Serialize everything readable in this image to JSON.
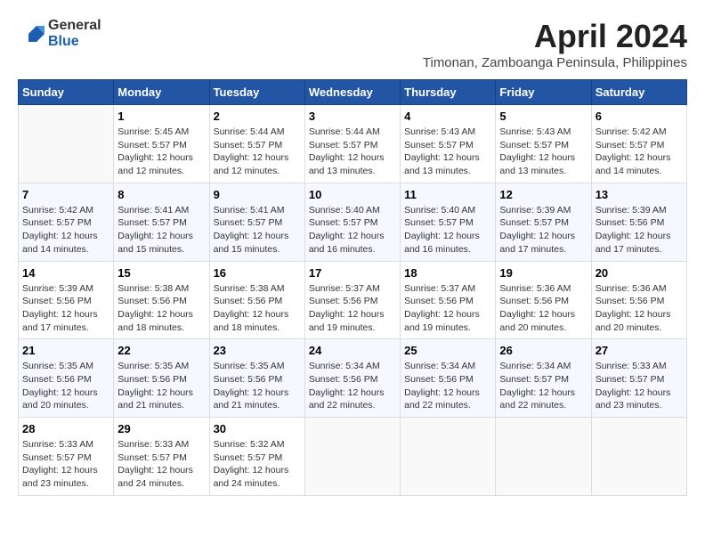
{
  "header": {
    "logo_general": "General",
    "logo_blue": "Blue",
    "month": "April 2024",
    "location": "Timonan, Zamboanga Peninsula, Philippines"
  },
  "columns": [
    "Sunday",
    "Monday",
    "Tuesday",
    "Wednesday",
    "Thursday",
    "Friday",
    "Saturday"
  ],
  "weeks": [
    [
      {
        "day": "",
        "detail": ""
      },
      {
        "day": "1",
        "detail": "Sunrise: 5:45 AM\nSunset: 5:57 PM\nDaylight: 12 hours\nand 12 minutes."
      },
      {
        "day": "2",
        "detail": "Sunrise: 5:44 AM\nSunset: 5:57 PM\nDaylight: 12 hours\nand 12 minutes."
      },
      {
        "day": "3",
        "detail": "Sunrise: 5:44 AM\nSunset: 5:57 PM\nDaylight: 12 hours\nand 13 minutes."
      },
      {
        "day": "4",
        "detail": "Sunrise: 5:43 AM\nSunset: 5:57 PM\nDaylight: 12 hours\nand 13 minutes."
      },
      {
        "day": "5",
        "detail": "Sunrise: 5:43 AM\nSunset: 5:57 PM\nDaylight: 12 hours\nand 13 minutes."
      },
      {
        "day": "6",
        "detail": "Sunrise: 5:42 AM\nSunset: 5:57 PM\nDaylight: 12 hours\nand 14 minutes."
      }
    ],
    [
      {
        "day": "7",
        "detail": "Sunrise: 5:42 AM\nSunset: 5:57 PM\nDaylight: 12 hours\nand 14 minutes."
      },
      {
        "day": "8",
        "detail": "Sunrise: 5:41 AM\nSunset: 5:57 PM\nDaylight: 12 hours\nand 15 minutes."
      },
      {
        "day": "9",
        "detail": "Sunrise: 5:41 AM\nSunset: 5:57 PM\nDaylight: 12 hours\nand 15 minutes."
      },
      {
        "day": "10",
        "detail": "Sunrise: 5:40 AM\nSunset: 5:57 PM\nDaylight: 12 hours\nand 16 minutes."
      },
      {
        "day": "11",
        "detail": "Sunrise: 5:40 AM\nSunset: 5:57 PM\nDaylight: 12 hours\nand 16 minutes."
      },
      {
        "day": "12",
        "detail": "Sunrise: 5:39 AM\nSunset: 5:57 PM\nDaylight: 12 hours\nand 17 minutes."
      },
      {
        "day": "13",
        "detail": "Sunrise: 5:39 AM\nSunset: 5:56 PM\nDaylight: 12 hours\nand 17 minutes."
      }
    ],
    [
      {
        "day": "14",
        "detail": "Sunrise: 5:39 AM\nSunset: 5:56 PM\nDaylight: 12 hours\nand 17 minutes."
      },
      {
        "day": "15",
        "detail": "Sunrise: 5:38 AM\nSunset: 5:56 PM\nDaylight: 12 hours\nand 18 minutes."
      },
      {
        "day": "16",
        "detail": "Sunrise: 5:38 AM\nSunset: 5:56 PM\nDaylight: 12 hours\nand 18 minutes."
      },
      {
        "day": "17",
        "detail": "Sunrise: 5:37 AM\nSunset: 5:56 PM\nDaylight: 12 hours\nand 19 minutes."
      },
      {
        "day": "18",
        "detail": "Sunrise: 5:37 AM\nSunset: 5:56 PM\nDaylight: 12 hours\nand 19 minutes."
      },
      {
        "day": "19",
        "detail": "Sunrise: 5:36 AM\nSunset: 5:56 PM\nDaylight: 12 hours\nand 20 minutes."
      },
      {
        "day": "20",
        "detail": "Sunrise: 5:36 AM\nSunset: 5:56 PM\nDaylight: 12 hours\nand 20 minutes."
      }
    ],
    [
      {
        "day": "21",
        "detail": "Sunrise: 5:35 AM\nSunset: 5:56 PM\nDaylight: 12 hours\nand 20 minutes."
      },
      {
        "day": "22",
        "detail": "Sunrise: 5:35 AM\nSunset: 5:56 PM\nDaylight: 12 hours\nand 21 minutes."
      },
      {
        "day": "23",
        "detail": "Sunrise: 5:35 AM\nSunset: 5:56 PM\nDaylight: 12 hours\nand 21 minutes."
      },
      {
        "day": "24",
        "detail": "Sunrise: 5:34 AM\nSunset: 5:56 PM\nDaylight: 12 hours\nand 22 minutes."
      },
      {
        "day": "25",
        "detail": "Sunrise: 5:34 AM\nSunset: 5:56 PM\nDaylight: 12 hours\nand 22 minutes."
      },
      {
        "day": "26",
        "detail": "Sunrise: 5:34 AM\nSunset: 5:57 PM\nDaylight: 12 hours\nand 22 minutes."
      },
      {
        "day": "27",
        "detail": "Sunrise: 5:33 AM\nSunset: 5:57 PM\nDaylight: 12 hours\nand 23 minutes."
      }
    ],
    [
      {
        "day": "28",
        "detail": "Sunrise: 5:33 AM\nSunset: 5:57 PM\nDaylight: 12 hours\nand 23 minutes."
      },
      {
        "day": "29",
        "detail": "Sunrise: 5:33 AM\nSunset: 5:57 PM\nDaylight: 12 hours\nand 24 minutes."
      },
      {
        "day": "30",
        "detail": "Sunrise: 5:32 AM\nSunset: 5:57 PM\nDaylight: 12 hours\nand 24 minutes."
      },
      {
        "day": "",
        "detail": ""
      },
      {
        "day": "",
        "detail": ""
      },
      {
        "day": "",
        "detail": ""
      },
      {
        "day": "",
        "detail": ""
      }
    ]
  ]
}
